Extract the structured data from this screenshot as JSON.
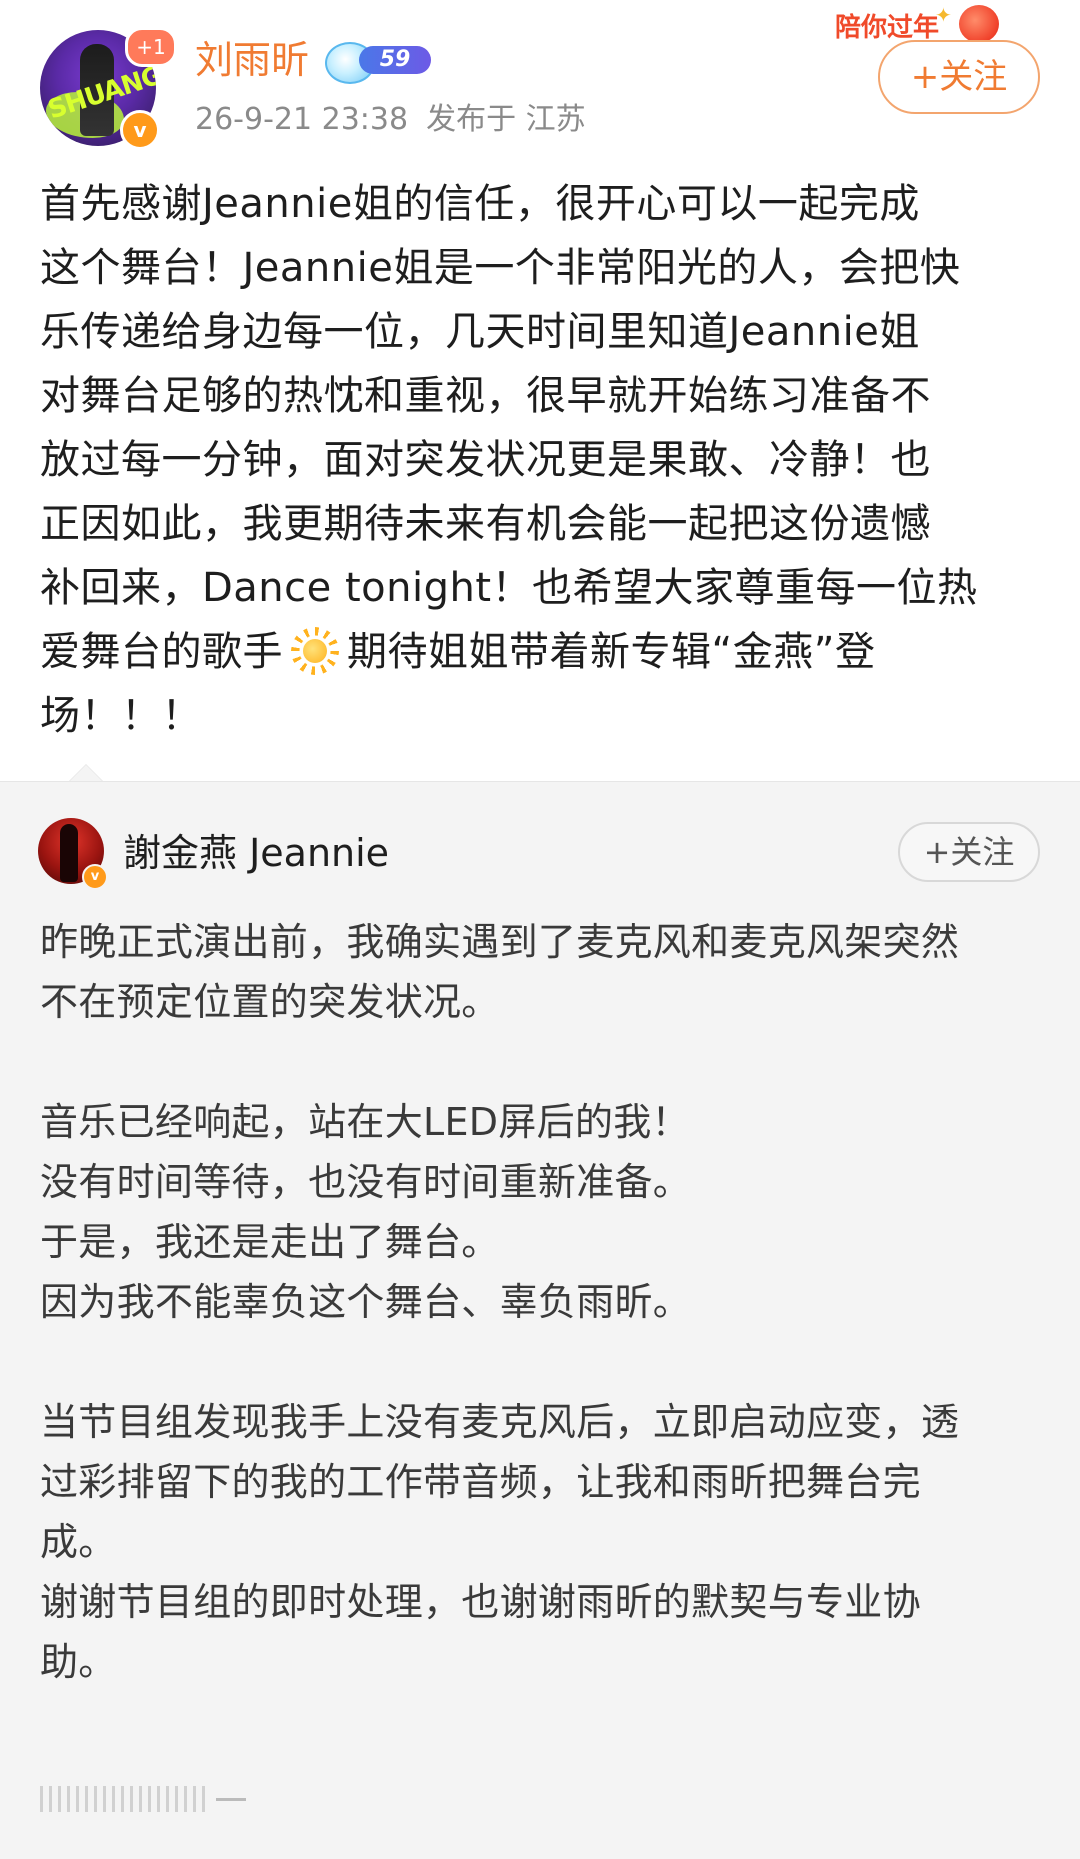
{
  "post": {
    "author": {
      "name": "刘雨昕",
      "plus_badge": "+1",
      "verified_mark": "v",
      "level": "59",
      "avatar_text": "SHUANG"
    },
    "banner_text": "陪你过年",
    "follow_button": "+关注",
    "timestamp": "26-9-21 23:38",
    "location": "发布于 江苏",
    "text_before_emoji": "首先感谢Jeannie姐的信任，很开心可以一起完成\n这个舞台！Jeannie姐是一个非常阳光的人，会把快\n乐传递给身边每一位，几天时间里知道Jeannie姐\n对舞台足够的热忱和重视，很早就开始练习准备不\n放过每一分钟，面对突发状况更是果敢、冷静！也\n正因如此，我更期待未来有机会能一起把这份遗憾\n补回来，Dance tonight！也希望大家尊重每一位热\n爱舞台的歌手",
    "emoji": "sun-emoji",
    "text_after_emoji": "期待姐姐带着新专辑“金燕”登\n场！！！"
  },
  "repost": {
    "author": {
      "name": "謝金燕 Jeannie",
      "verified_mark": "v"
    },
    "follow_button": "+关注",
    "text": "昨晚正式演出前，我确实遇到了麦克风和麦克风架突然\n不在预定位置的突发状况。\n\n音乐已经响起，站在大LED屏后的我！\n没有时间等待，也没有时间重新准备。\n于是，我还是走出了舞台。\n因为我不能辜负这个舞台、辜负雨昕。\n\n当节目组发现我手上没有麦克风后，立即启动应变，透\n过彩排留下的我的工作带音频，让我和雨昕把舞台完\n成。\n谢谢节目组的即时处理，也谢谢雨昕的默契与专业协\n助。"
  },
  "colors": {
    "username_orange": "#f07b32",
    "follow_border": "#f3a56e",
    "meta_gray": "#8a8a8a",
    "body_text": "#1e1e1e",
    "repost_bg": "#f4f4f4",
    "repost_text": "#3a3a3a",
    "verified_orange": "#ff9a1a",
    "banner_red": "#f04a2a"
  }
}
